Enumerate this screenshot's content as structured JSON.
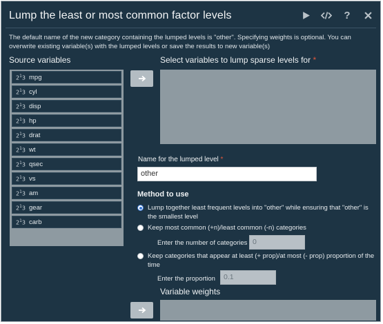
{
  "header": {
    "title": "Lump the least or most common factor levels",
    "icons": [
      "run-icon",
      "code-icon",
      "help-icon",
      "close-icon"
    ]
  },
  "description": "The default name of the new category containing the lumped levels is \"other\". Specifying weights is optional. You can overwrite existing variable(s) with the lumped levels or save the results to new variable(s)",
  "source": {
    "label": "Source variables",
    "items": [
      "mpg",
      "cyl",
      "disp",
      "hp",
      "drat",
      "wt",
      "qsec",
      "vs",
      "am",
      "gear",
      "carb"
    ],
    "type_icon": "2",
    "type_icon_sup": "1",
    "type_icon_tail": "3"
  },
  "target": {
    "label": "Select variables to lump sparse levels for",
    "required_mark": "*"
  },
  "lumped_name": {
    "label": "Name for the lumped level",
    "required_mark": "*",
    "value": "other"
  },
  "method": {
    "heading": "Method to use",
    "options": [
      {
        "label": "Lump together least frequent levels into \"other\" while ensuring that \"other\" is the smallest level",
        "checked": true
      },
      {
        "label": "Keep most common (+n)/least common (-n) categories",
        "checked": false
      },
      {
        "label": "Keep categories that appear at least (+ prop)/at most (- prop) proportion of the time",
        "checked": false
      }
    ],
    "n_categories_label": "Enter the number of categories",
    "n_categories_value": "0",
    "proportion_label": "Enter the proportion",
    "proportion_value": "0.1"
  },
  "weights": {
    "label": "Variable weights"
  },
  "colors": {
    "background": "#1d3444",
    "panel": "#8e9aa1",
    "accent": "#3a7ad9",
    "required": "#e0573b"
  }
}
